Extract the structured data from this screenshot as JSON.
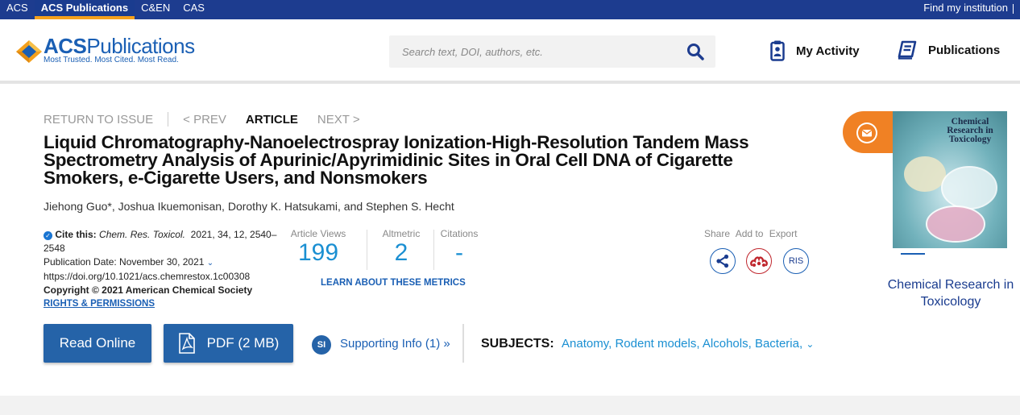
{
  "topnav": {
    "items": [
      "ACS",
      "ACS Publications",
      "C&EN",
      "CAS"
    ],
    "active_index": 1,
    "institution": "Find my institution"
  },
  "header": {
    "logo_name_bold": "ACS",
    "logo_name_rest": "Publications",
    "logo_tagline": "Most Trusted. Most Cited. Most Read.",
    "search_placeholder": "Search text, DOI, authors, etc.",
    "my_activity": "My Activity",
    "publications": "Publications"
  },
  "issue_nav": {
    "return": "RETURN TO ISSUE",
    "prev": "< PREV",
    "current": "ARTICLE",
    "next": "NEXT >"
  },
  "article": {
    "title": "Liquid Chromatography-Nanoelectrospray Ionization-High-Resolution Tandem Mass Spectrometry Analysis of Apurinic/Apyrimidinic Sites in Oral Cell DNA of Cigarette Smokers, e-Cigarette Users, and Nonsmokers",
    "authors": [
      {
        "name": "Jiehong Guo*",
        "sep": ", "
      },
      {
        "name": "Joshua Ikuemonisan",
        "sep": ", "
      },
      {
        "name": "Dorothy K. Hatsukami",
        "sep": ", and "
      },
      {
        "name": "Stephen S. Hecht",
        "sep": ""
      }
    ]
  },
  "cite": {
    "label": "Cite this:",
    "journal": "Chem. Res. Toxicol.",
    "details_line1": "2021, 34, 12, 2540–",
    "details_line2": "2548",
    "pub_date": "Publication Date: November 30, 2021",
    "doi": "https://doi.org/10.1021/acs.chemrestox.1c00308",
    "copyright": "Copyright © 2021 American Chemical Society",
    "rights": "RIGHTS & PERMISSIONS"
  },
  "metrics": {
    "views_label": "Article Views",
    "views_value": "199",
    "altmetric_label": "Altmetric",
    "altmetric_value": "2",
    "citations_label": "Citations",
    "citations_value": "-",
    "learn": "LEARN ABOUT THESE METRICS"
  },
  "tools": {
    "share": "Share",
    "add_to": "Add to",
    "export": "Export",
    "ris": "RIS"
  },
  "journal": {
    "cover_title": "Chemical Research in Toxicology",
    "link_text": "Chemical Research in Toxicology"
  },
  "actions": {
    "read_online": "Read Online",
    "pdf": "PDF (2 MB)",
    "si_badge": "SI",
    "supporting": "Supporting Info (1) »",
    "subjects_label": "SUBJECTS:",
    "subjects": [
      "Anatomy",
      "Rodent models",
      "Alcohols",
      "Bacteria"
    ]
  },
  "colors": {
    "topbar": "#1d3c8f",
    "accent_orange": "#f08124",
    "link_blue": "#1a5fb4",
    "metric_blue": "#1a8fd2",
    "button_blue": "#2563a8",
    "mendeley_red": "#c0262d"
  }
}
